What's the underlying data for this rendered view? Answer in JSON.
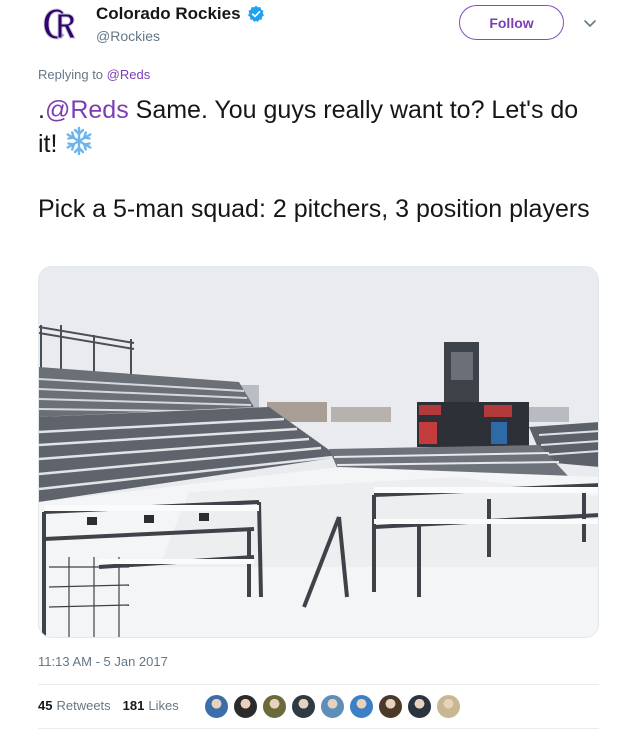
{
  "author": {
    "display_name": "Colorado Rockies",
    "handle": "@Rockies",
    "verified_icon": "verified-badge-icon",
    "colors": {
      "brand": "#33006f",
      "accent": "#7b3fb3"
    }
  },
  "actions": {
    "follow_label": "Follow",
    "more_icon": "chevron-down-icon"
  },
  "reply": {
    "prefix": "Replying to ",
    "mention": "@Reds"
  },
  "tweet": {
    "prefix": ".",
    "mention": "@Reds",
    "text_1": " Same. You guys really want to? Let's do it! ",
    "emoji_icon": "snowflake-icon",
    "paragraph_2": "Pick a 5-man squad: 2 pitchers, 3 position players"
  },
  "media": {
    "icon": "photo-snowy-stadium"
  },
  "meta": {
    "timestamp": "11:13 AM - 5 Jan 2017"
  },
  "stats": {
    "retweets_count": "45",
    "retweets_label": "Retweets",
    "likes_count": "181",
    "likes_label": "Likes"
  },
  "likers": [
    {
      "name": "liker-avatar-1",
      "color": "#3b6ea8"
    },
    {
      "name": "liker-avatar-2",
      "color": "#2b2b2b"
    },
    {
      "name": "liker-avatar-3",
      "color": "#6b6a3a"
    },
    {
      "name": "liker-avatar-4",
      "color": "#2f3b44"
    },
    {
      "name": "liker-avatar-5",
      "color": "#5e8fb8"
    },
    {
      "name": "liker-avatar-6",
      "color": "#3c7fc4"
    },
    {
      "name": "liker-avatar-7",
      "color": "#4a3a2a"
    },
    {
      "name": "liker-avatar-8",
      "color": "#2a3340"
    },
    {
      "name": "liker-avatar-9",
      "color": "#c7b892"
    }
  ]
}
